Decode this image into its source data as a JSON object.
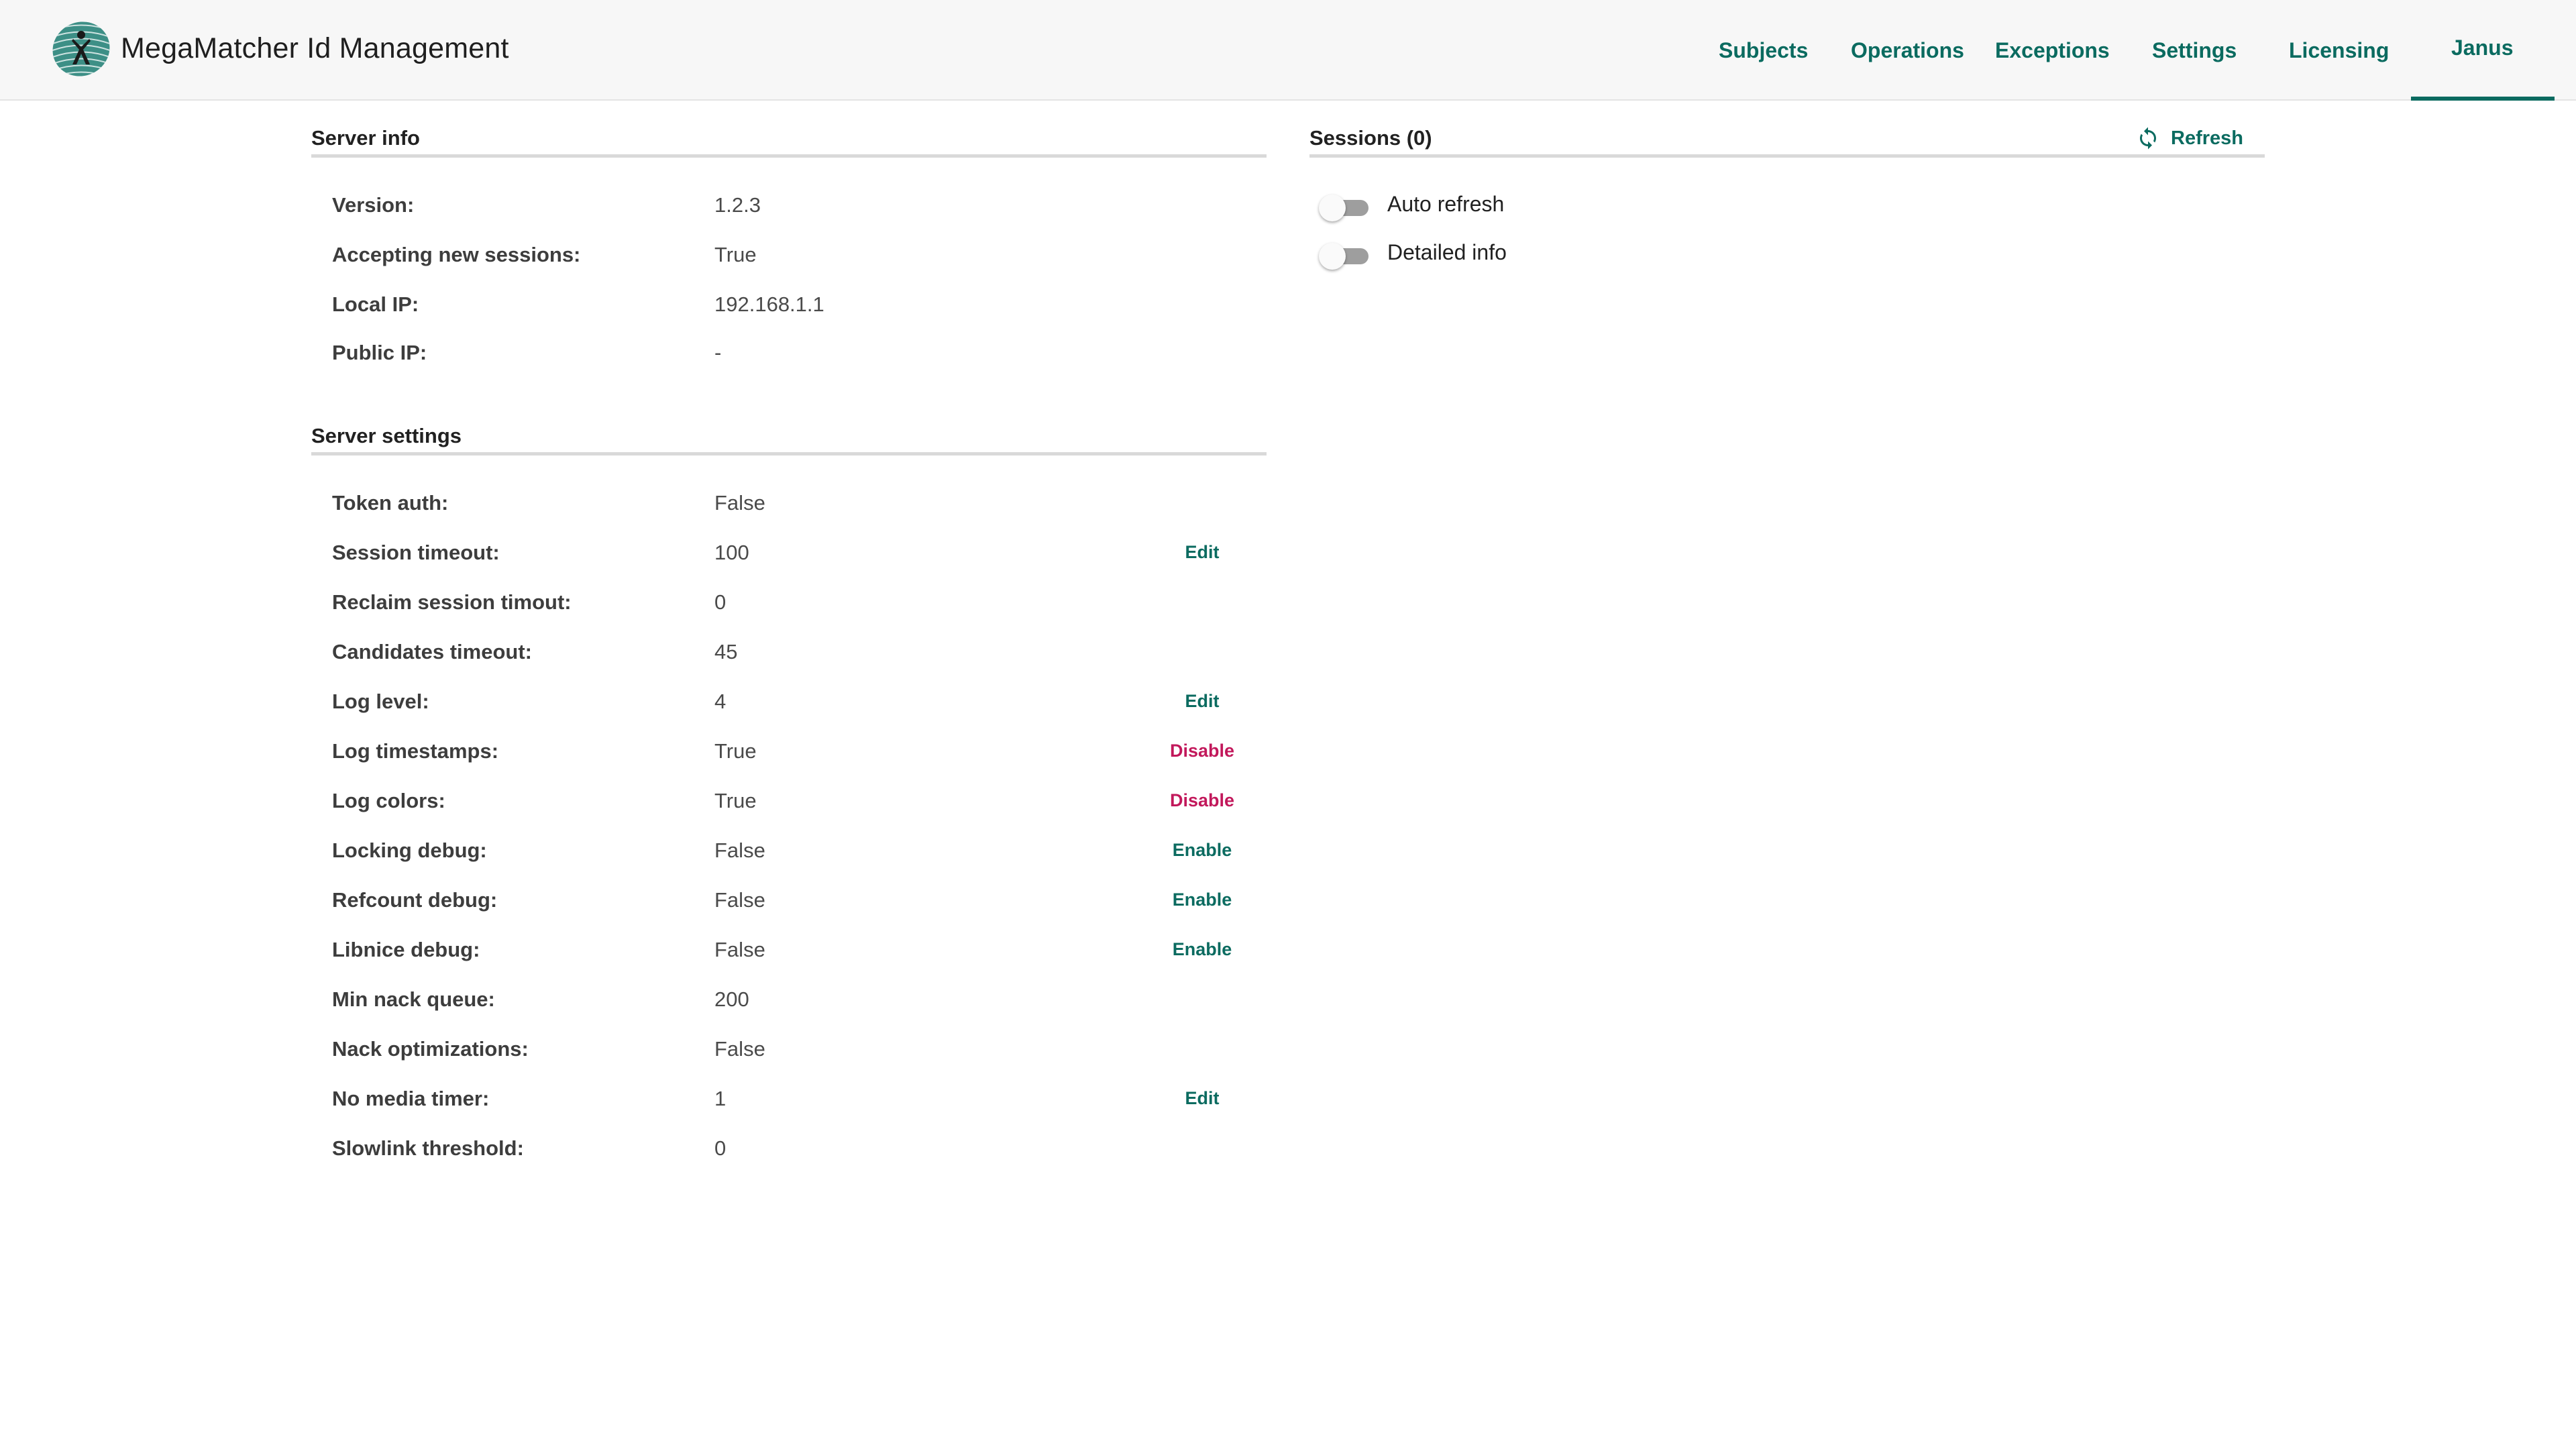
{
  "header": {
    "title": "MegaMatcher Id Management",
    "logo_icon": "megamatcher-logo-icon",
    "nav": [
      {
        "label": "Subjects"
      },
      {
        "label": "Operations"
      },
      {
        "label": "Exceptions"
      },
      {
        "label": "Settings"
      },
      {
        "label": "Licensing"
      },
      {
        "label": "Janus",
        "active": true
      }
    ],
    "accent_color": "#0b6b60"
  },
  "server_info": {
    "title": "Server info",
    "rows": [
      {
        "label": "Version:",
        "value": "1.2.3"
      },
      {
        "label": "Accepting new sessions:",
        "value": "True"
      },
      {
        "label": "Local IP:",
        "value": "192.168.1.1"
      },
      {
        "label": "Public IP:",
        "value": "-"
      }
    ]
  },
  "server_settings": {
    "title": "Server settings",
    "rows": [
      {
        "label": "Token auth:",
        "value": "False",
        "action": ""
      },
      {
        "label": "Session timeout:",
        "value": "100",
        "action": "Edit"
      },
      {
        "label": "Reclaim session timout:",
        "value": "0",
        "action": ""
      },
      {
        "label": "Candidates timeout:",
        "value": "45",
        "action": ""
      },
      {
        "label": "Log level:",
        "value": "4",
        "action": "Edit"
      },
      {
        "label": "Log timestamps:",
        "value": "True",
        "action": "Disable"
      },
      {
        "label": "Log colors:",
        "value": "True",
        "action": "Disable"
      },
      {
        "label": "Locking debug:",
        "value": "False",
        "action": "Enable"
      },
      {
        "label": "Refcount debug:",
        "value": "False",
        "action": "Enable"
      },
      {
        "label": "Libnice debug:",
        "value": "False",
        "action": "Enable"
      },
      {
        "label": "Min nack queue:",
        "value": "200",
        "action": ""
      },
      {
        "label": "Nack optimizations:",
        "value": "False",
        "action": ""
      },
      {
        "label": "No media timer:",
        "value": "1",
        "action": "Edit"
      },
      {
        "label": "Slowlink threshold:",
        "value": "0",
        "action": ""
      }
    ],
    "action_colors": {
      "Edit": "#0b6b60",
      "Enable": "#0b6b60",
      "Disable": "#c2185b"
    }
  },
  "sessions": {
    "title": "Sessions (0)",
    "refresh_label": "Refresh",
    "refresh_icon": "refresh-icon",
    "toggles": [
      {
        "label": "Auto refresh",
        "on": false
      },
      {
        "label": "Detailed info",
        "on": false
      }
    ]
  }
}
